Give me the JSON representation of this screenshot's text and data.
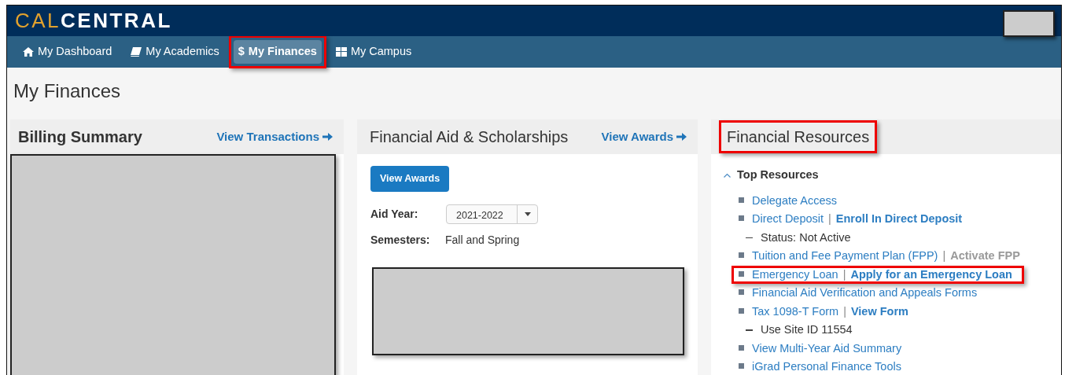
{
  "header": {
    "logo_accent": "CAL",
    "logo_main": "CENTRAL"
  },
  "nav": [
    {
      "label": "My Dashboard",
      "selected": false,
      "highlighted": false
    },
    {
      "label": "My Academics",
      "selected": false,
      "highlighted": false
    },
    {
      "label": "My Finances",
      "glyph": "$",
      "selected": true,
      "highlighted": true
    },
    {
      "label": "My Campus",
      "selected": false,
      "highlighted": false
    }
  ],
  "page_title": "My Finances",
  "billing": {
    "title": "Billing Summary",
    "link": "View Transactions"
  },
  "aid": {
    "title": "Financial Aid & Scholarships",
    "link": "View Awards",
    "button": "View Awards",
    "aid_year_label": "Aid Year:",
    "aid_year": "2021-2022",
    "semesters_label": "Semesters:",
    "semesters": "Fall and Spring"
  },
  "resources": {
    "title": "Financial Resources",
    "title_highlighted": true,
    "section": "Top Resources",
    "expanded": true,
    "items": [
      {
        "label": "Delegate Access",
        "highlighted": false
      },
      {
        "label": "Direct Deposit",
        "separator": "|",
        "action": "Enroll In Direct Deposit",
        "action_disabled": false,
        "highlighted": false,
        "children": [
          {
            "text": "Status: Not Active"
          }
        ]
      },
      {
        "label": "Tuition and Fee Payment Plan (FPP)",
        "separator": "|",
        "action": "Activate FPP",
        "action_disabled": true,
        "highlighted": false
      },
      {
        "label": "Emergency Loan",
        "separator": "|",
        "action": "Apply for an Emergency Loan",
        "action_disabled": false,
        "highlighted": true
      },
      {
        "label": "Financial Aid Verification and Appeals Forms",
        "highlighted": false
      },
      {
        "label": "Tax 1098-T Form",
        "separator": "|",
        "action": "View Form",
        "action_disabled": false,
        "highlighted": false,
        "children": [
          {
            "text": "Use Site ID 11554"
          }
        ]
      },
      {
        "label": "View Multi-Year Aid Summary",
        "highlighted": false
      },
      {
        "label": "iGrad Personal Finance Tools",
        "highlighted": false
      }
    ]
  }
}
